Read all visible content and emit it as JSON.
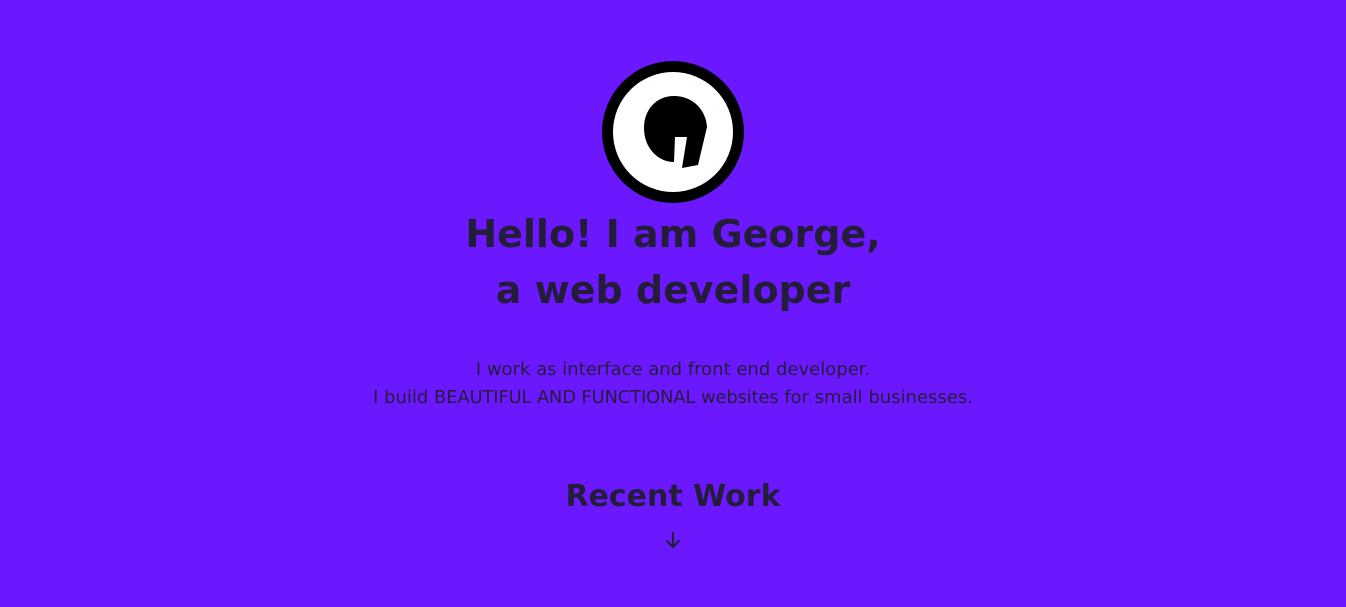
{
  "header": {
    "logo_icon": "g-logo-icon",
    "title_line1": "Hello! I am George,",
    "title_line2": "a web developer"
  },
  "intro": {
    "line1": "I work as interface and front end developer.",
    "line2_prefix": "I build ",
    "line2_emphasis1": "BEAUTIFUL AND FUNCTIONAL",
    "line2_space": " ",
    "line2_emphasis2": "websites",
    "line2_suffix": " for small businesses."
  },
  "recent": {
    "label": "Recent Work",
    "arrow_icon": "arrow-down-icon"
  },
  "colors": {
    "background": "#6b18ff",
    "text": "#241d3a",
    "logo_ring": "#000000",
    "logo_face": "#ffffff"
  }
}
